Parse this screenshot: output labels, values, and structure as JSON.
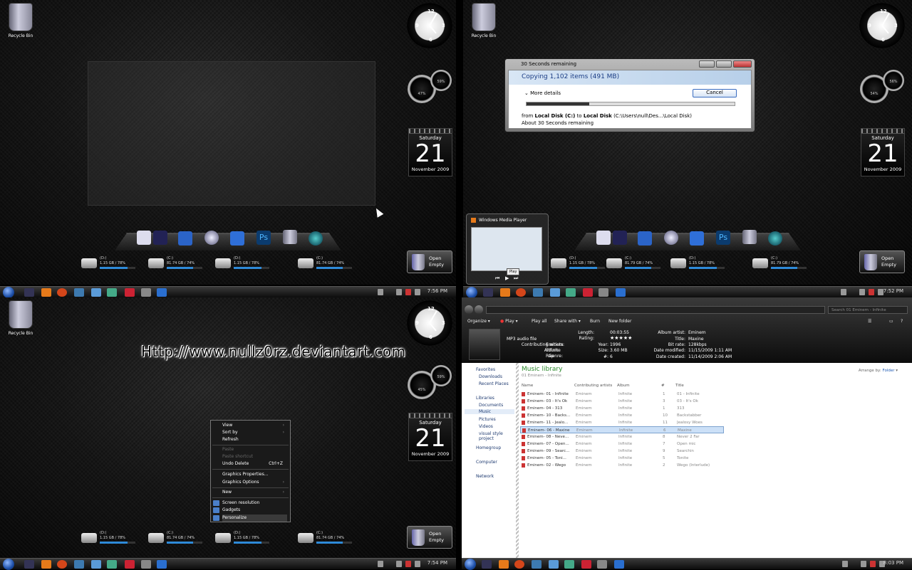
{
  "recycle_bin_label": "Recycle Bin",
  "calendar": {
    "day": "Saturday",
    "date": "21",
    "month": "November 2009"
  },
  "meters": {
    "cpu": "47%",
    "ram": "59%",
    "cpu2": "54%",
    "ram2": "56%",
    "cpu3": "45%",
    "ram3": "59%"
  },
  "clock_numbers": {
    "n12": "12",
    "n3": "3",
    "n6": "6",
    "n9": "9"
  },
  "drives": [
    {
      "letter": "(D:)",
      "stats": "1.15 GB / 78%",
      "usage": 0.78
    },
    {
      "letter": "(C:)",
      "stats": "81.74 GB / 74%",
      "usage": 0.74
    },
    {
      "letter": "(D:)",
      "stats": "1.15 GB / 78%",
      "usage": 0.78
    },
    {
      "letter": "(C:)",
      "stats": "81.74 GB / 74%",
      "usage": 0.74
    }
  ],
  "drives_q2": [
    {
      "letter": "(D:)",
      "stats": "1.15 GB / 78%",
      "usage": 0.78
    },
    {
      "letter": "(C:)",
      "stats": "81.79 GB / 74%",
      "usage": 0.74
    },
    {
      "letter": "(D:)",
      "stats": "1.15 GB / 78%",
      "usage": 0.78
    },
    {
      "letter": "(C:)",
      "stats": "81.79 GB / 74%",
      "usage": 0.74
    }
  ],
  "bin_gadget": {
    "open": "Open",
    "empty": "Empty"
  },
  "taskbar_times": {
    "q1": "7:56 PM",
    "q2": "7:52 PM",
    "q3": "7:54 PM",
    "q4": "8:03 PM"
  },
  "copy_dialog": {
    "title": "30 Seconds remaining",
    "header": "Copying 1,102 items (491 MB)",
    "more_details": "More details",
    "cancel": "Cancel",
    "from_prefix": "from",
    "from": "Local Disk (C:)",
    "to_prefix": "to",
    "to": "Local Disk",
    "path": "(C:\\Users\\null\\Des...\\Local Disk)",
    "remaining": "About 30 Seconds remaining",
    "progress": 0.3
  },
  "wmp_preview": {
    "title": "Windows Media Player",
    "tooltip": "Play"
  },
  "watermark": "Http://www.nullz0rz.deviantart.com",
  "context_menu": [
    {
      "label": "View",
      "arrow": true,
      "disabled": false
    },
    {
      "label": "Sort by",
      "arrow": true,
      "disabled": false
    },
    {
      "label": "Refresh",
      "arrow": false,
      "disabled": false
    },
    {
      "label": "Paste",
      "arrow": false,
      "disabled": true
    },
    {
      "label": "Paste shortcut",
      "arrow": false,
      "disabled": true
    },
    {
      "label": "Undo Delete",
      "shortcut": "Ctrl+Z",
      "arrow": false,
      "disabled": false
    },
    {
      "label": "Graphics Properties...",
      "arrow": false,
      "disabled": false
    },
    {
      "label": "Graphics Options",
      "arrow": true,
      "disabled": false
    },
    {
      "label": "New",
      "arrow": true,
      "disabled": false
    },
    {
      "label": "Screen resolution",
      "arrow": false,
      "disabled": false
    },
    {
      "label": "Gadgets",
      "arrow": false,
      "disabled": false
    },
    {
      "label": "Personalize",
      "arrow": false,
      "disabled": false
    }
  ],
  "explorer": {
    "search_placeholder": "Search 01 Eminem - Infinite",
    "toolbar": [
      "Organize",
      "Play",
      "Play all",
      "Share with",
      "Burn",
      "New folder"
    ],
    "details": {
      "file_type": "MP3 audio file",
      "length_label": "Length:",
      "length": "00:03:55",
      "rating_label": "Rating:",
      "rating": "★★★★★",
      "contributing_label": "Contributing artists:",
      "contributing": "Eminem",
      "year_label": "Year:",
      "year": "1996",
      "album_label": "Album:",
      "album": "Infinite",
      "size_label": "Size:",
      "size": "3.60 MB",
      "genre_label": "Genre:",
      "genre": "Rap",
      "num_label": "#:",
      "num": "6",
      "album_artist_label": "Album artist:",
      "album_artist": "Eminem",
      "title_label": "Title:",
      "title": "Maxine",
      "bitrate_label": "Bit rate:",
      "bitrate": "128kbps",
      "modified_label": "Date modified:",
      "modified": "11/15/2009 1:11 AM",
      "created_label": "Date created:",
      "created": "11/14/2009 2:06 AM"
    },
    "nav": {
      "favorites": "Favorites",
      "downloads": "Downloads",
      "recent": "Recent Places",
      "libraries": "Libraries",
      "documents": "Documents",
      "music": "Music",
      "pictures": "Pictures",
      "videos": "Videos",
      "vsp": "visual style project",
      "homegroup": "Homegroup",
      "computer": "Computer",
      "network": "Network"
    },
    "library_title": "Music library",
    "library_sub": "01 Eminem - Infinite",
    "arrange_label": "Arrange by:",
    "arrange_value": "Folder",
    "columns": [
      "Name",
      "Contributing artists",
      "Album",
      "#",
      "Title"
    ],
    "rows": [
      [
        "Eminem- 01 - Infinite",
        "Eminem",
        "Infinite",
        "1",
        "01 - Infinite"
      ],
      [
        "Eminem- 03 - It's Ok",
        "Eminem",
        "Infinite",
        "3",
        "03 - It's Ok"
      ],
      [
        "Eminem- 04 - 313",
        "Eminem",
        "Infinite",
        "1",
        "313"
      ],
      [
        "Eminem- 10 - Backs...",
        "Eminem",
        "Infinite",
        "10",
        "Backstabber"
      ],
      [
        "Eminem- 11 - Jealo...",
        "Eminem",
        "Infinite",
        "11",
        "Jealosy Woes"
      ],
      [
        "Eminem- 06 - Maxine",
        "Eminem",
        "Infinite",
        "6",
        "Maxine"
      ],
      [
        "Eminem- 08 - Neve...",
        "Eminem",
        "Infinite",
        "8",
        "Never 2 Far"
      ],
      [
        "Eminem- 07 - Open...",
        "Eminem",
        "Infinite",
        "7",
        "Open mic"
      ],
      [
        "Eminem- 09 - Searc...",
        "Eminem",
        "Infinite",
        "9",
        "Searchin"
      ],
      [
        "Eminem- 05 - Toni...",
        "Eminem",
        "Infinite",
        "5",
        "Tonite"
      ],
      [
        "Eminem- 02 - Wego",
        "Eminem",
        "Infinite",
        "2",
        "Wego (Interlude)"
      ]
    ],
    "selected_row": 5
  }
}
